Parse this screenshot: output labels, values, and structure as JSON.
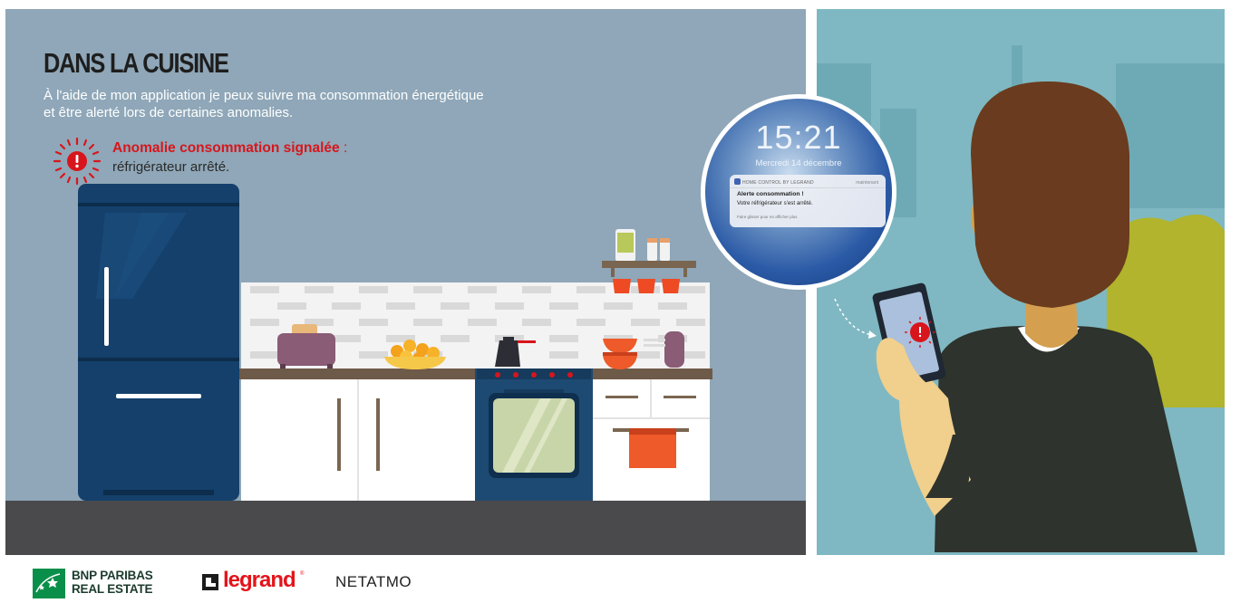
{
  "header": {
    "title": "DANS LA CUISINE",
    "subtitle_line1": "À l'aide de mon application je peux suivre ma consommation énergétique",
    "subtitle_line2": "et être alerté lors de certaines anomalies."
  },
  "alert": {
    "headline": "Anomalie consommation signalée",
    "colon": " :",
    "detail": "réfrigérateur arrêté.",
    "icon": "alert-burst-icon",
    "color": "#d8151c"
  },
  "phone_zoom": {
    "time": "15:21",
    "date": "Mercredi 14 décembre",
    "notification": {
      "app_name": "HOME CONTROL BY LEGRAND",
      "when": "maintenant",
      "title": "Alerte consommation !",
      "text": "Votre réfrigérateur s'est arrêté.",
      "hint": "Faire glisser pour en afficher plus"
    }
  },
  "footer": {
    "bnp_line1": "BNP PARIBAS",
    "bnp_line2": "REAL ESTATE",
    "legrand": "legrand",
    "legrand_reg": "®",
    "netatmo": "NETATMO"
  },
  "colors": {
    "scene_bg": "#8fa7b8",
    "fridge": "#14406b",
    "accent_red": "#d8151c",
    "right_bg": "#7fb8c2"
  }
}
